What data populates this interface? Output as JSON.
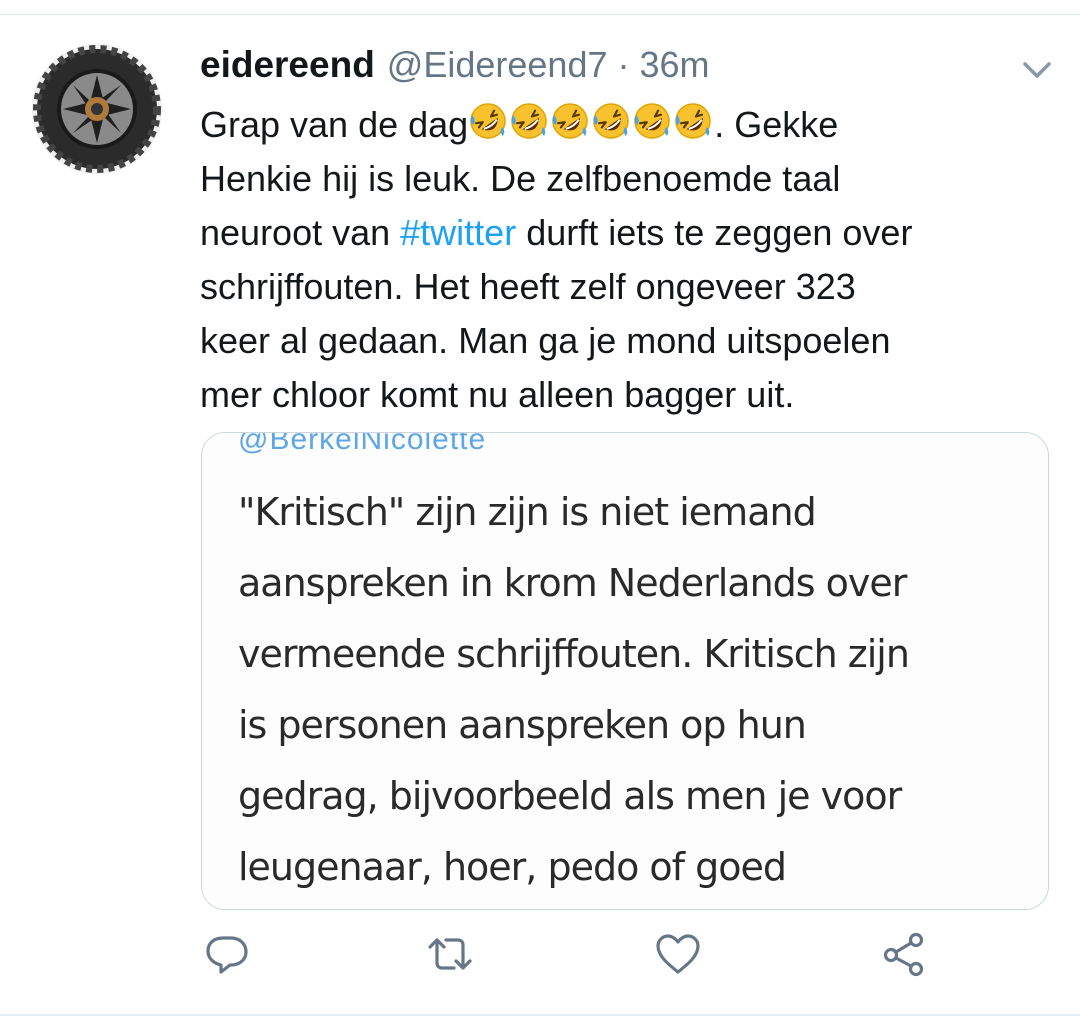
{
  "tweet": {
    "author": {
      "name": "eidereend",
      "handle": "@Eidereend7",
      "avatar": "wheel-tire-photo"
    },
    "separator": "·",
    "time": "36m",
    "text": {
      "line1_before": "Grap van de dag",
      "emoji": "rolling-on-the-floor-laughing",
      "emoji_count": 6,
      "line1_after": ". Gekke",
      "line2": "Henkie hij is leuk. De zelfbenoemde taal",
      "line3_before": "neuroot van ",
      "hashtag": "#twitter",
      "line3_after": " durft iets te zeggen over",
      "line4": "schrijffouten. Het heeft zelf ongeveer  323",
      "line5": "keer al gedaan. Man ga je mond uitspoelen",
      "line6": "mer chloor komt nu alleen bagger uit."
    },
    "quoted_image": {
      "handle": "@BerkelNicolette",
      "lines": [
        "\"Kritisch\" zijn zijn is niet iemand",
        "aanspreken in krom Nederlands over",
        "vermeende schrijffouten. Kritisch zijn",
        "is personen aanspreken op hun",
        "gedrag, bijvoorbeeld als men je voor",
        "leugenaar, hoer, pedo of goed"
      ]
    },
    "actions": [
      "reply-icon",
      "retweet-icon",
      "like-icon",
      "share-icon"
    ]
  },
  "colors": {
    "text": "#14171a",
    "muted": "#657786",
    "link": "#1da1f2",
    "border": "#ccd6dd",
    "icon": "#657786"
  }
}
